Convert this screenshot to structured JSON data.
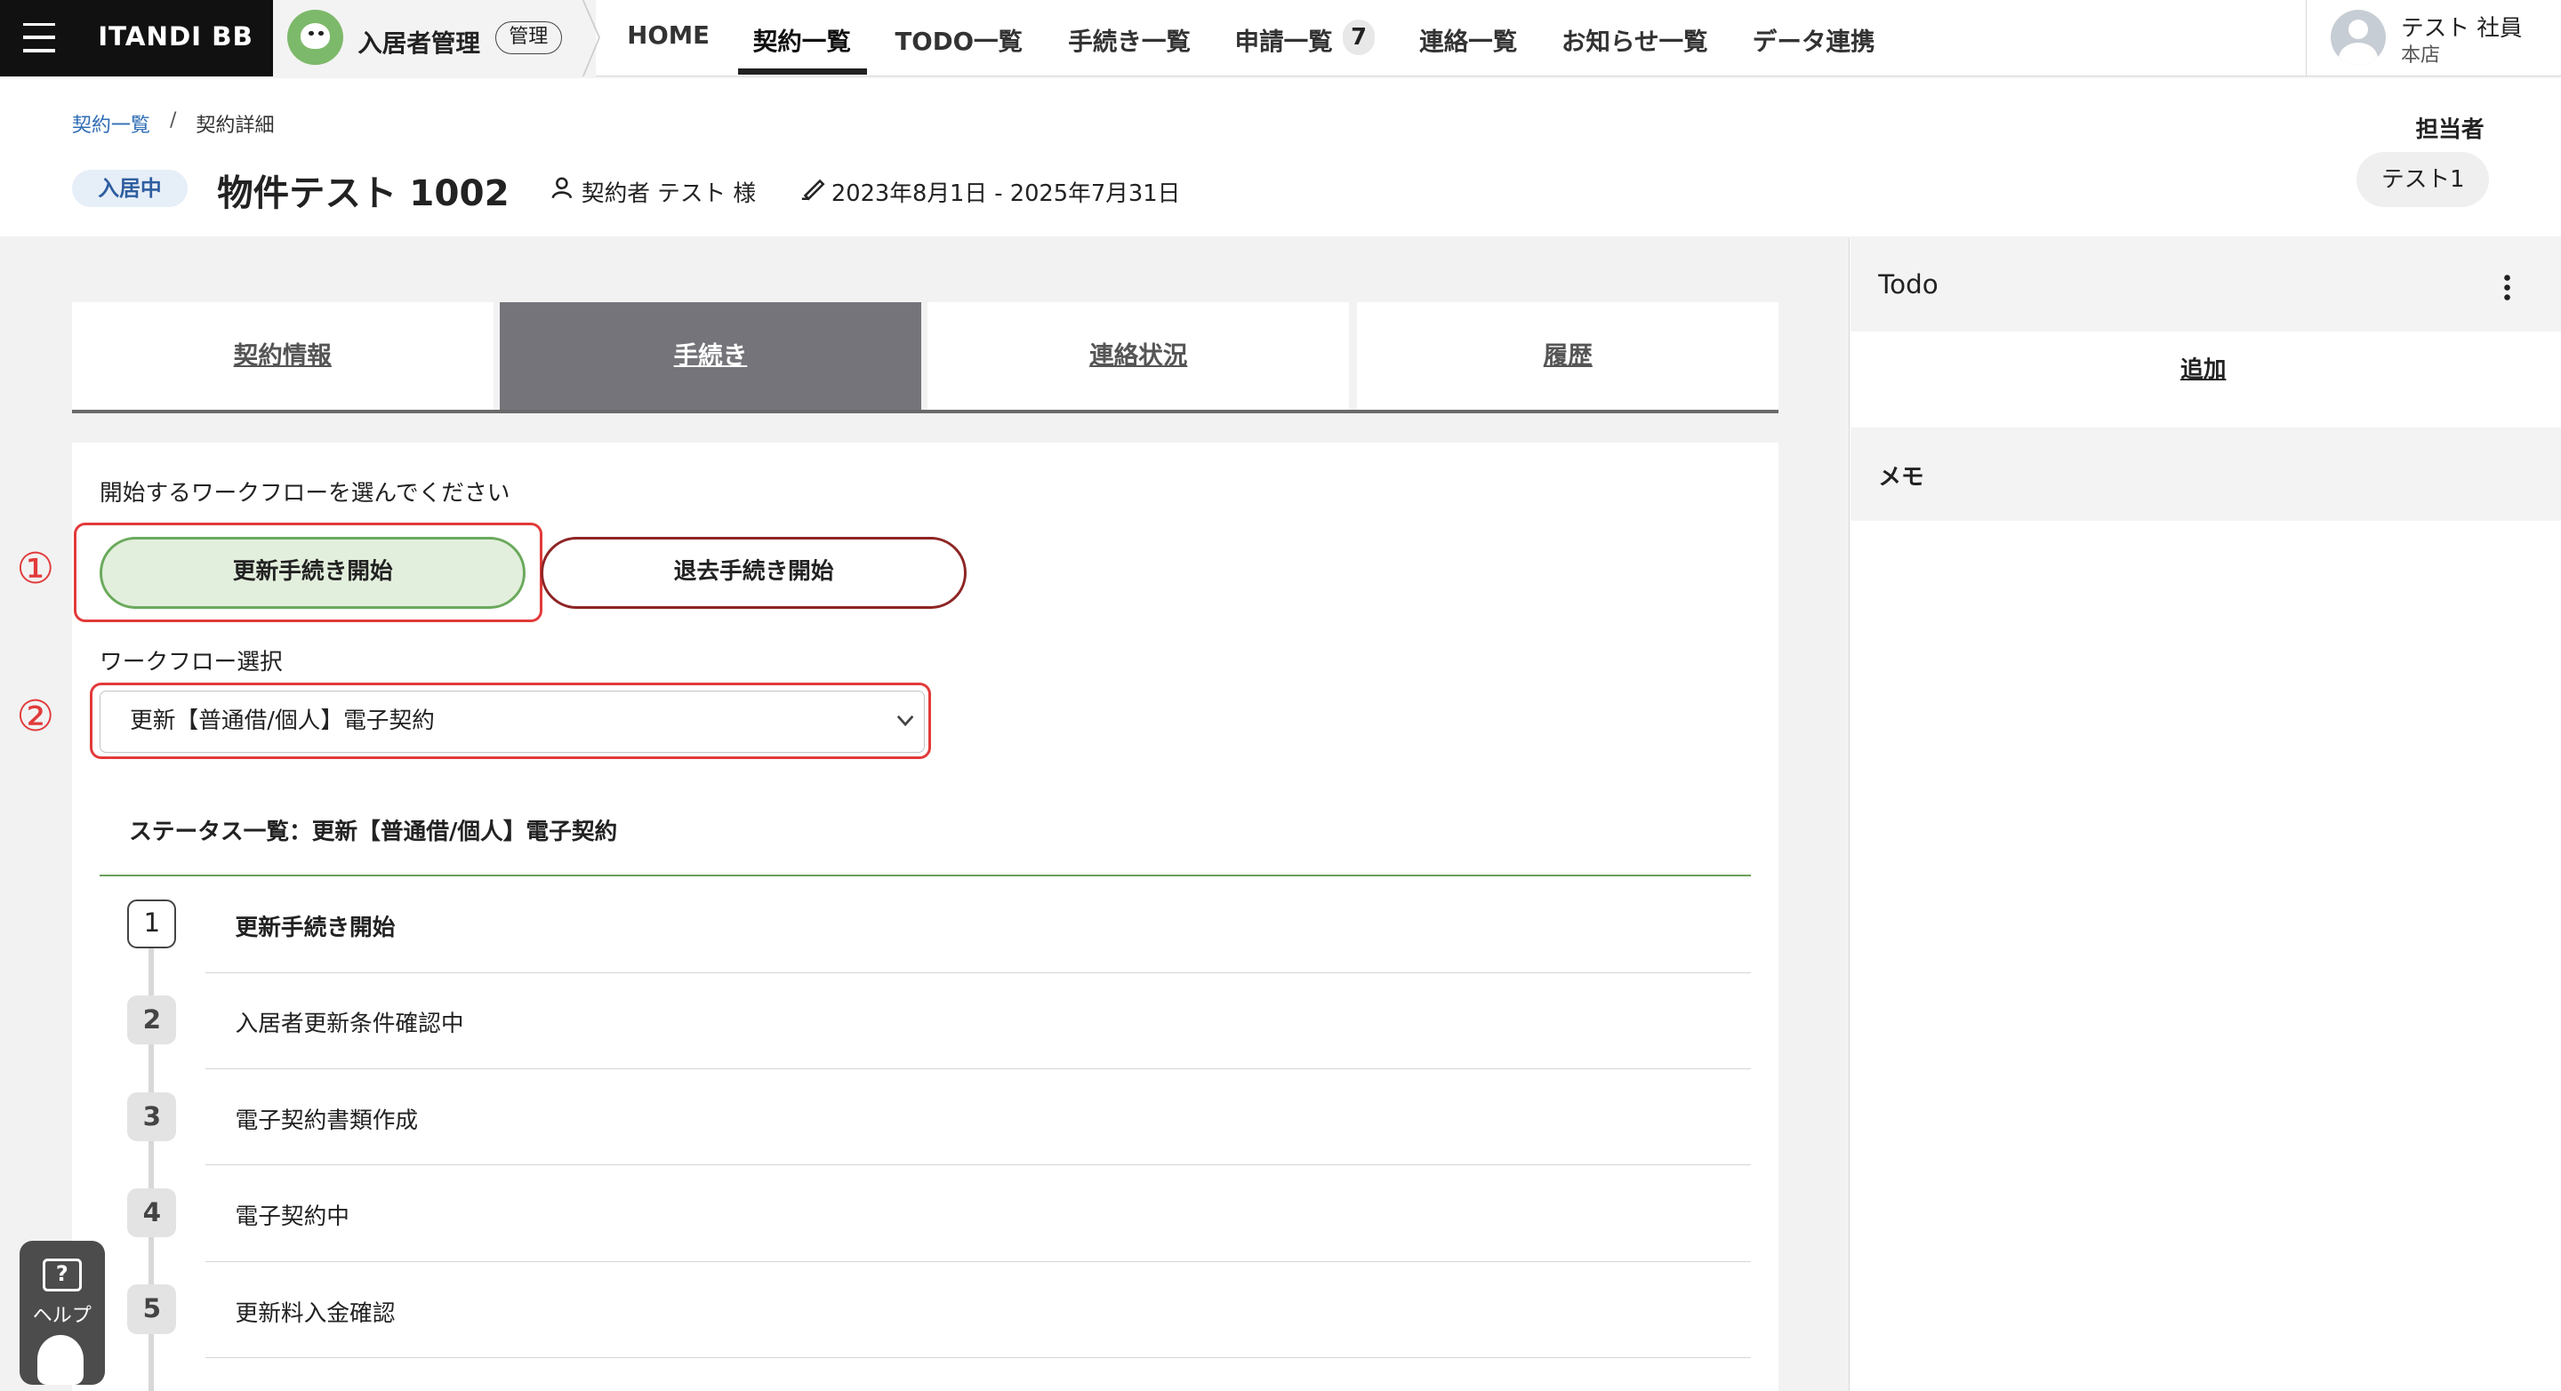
{
  "header": {
    "logo": "ITANDI BB",
    "app_title": "入居者管理",
    "app_badge": "管理",
    "nav": [
      {
        "label": "HOME"
      },
      {
        "label": "契約一覧"
      },
      {
        "label": "TODO一覧"
      },
      {
        "label": "手続き一覧"
      },
      {
        "label": "申請一覧"
      },
      {
        "label": "連絡一覧"
      },
      {
        "label": "お知らせ一覧"
      },
      {
        "label": "データ連携"
      }
    ],
    "application_count": "7",
    "user": {
      "name": "テスト 社員",
      "branch": "本店"
    }
  },
  "breadcrumb": {
    "parent": "契約一覧",
    "separator": "/",
    "current": "契約詳細"
  },
  "property": {
    "status": "入居中",
    "title": "物件テスト 1002",
    "contractor": "契約者 テスト 様",
    "period": "2023年8月1日 - 2025年7月31日"
  },
  "assignee": {
    "label": "担当者",
    "name": "テスト1"
  },
  "tabs": [
    {
      "label": "契約情報"
    },
    {
      "label": "手続き"
    },
    {
      "label": "連絡状況"
    },
    {
      "label": "履歴"
    }
  ],
  "workflow": {
    "prompt": "開始するワークフローを選んでください",
    "renew_button": "更新手続き開始",
    "past_button": "退去手続き開始",
    "select_label": "ワークフロー選択",
    "selected": "更新【普通借/個人】電子契約",
    "status_heading": "ステータス一覧：更新【普通借/個人】電子契約",
    "steps": [
      {
        "num": "1",
        "label": "更新手続き開始"
      },
      {
        "num": "2",
        "label": "入居者更新条件確認中"
      },
      {
        "num": "3",
        "label": "電子契約書類作成"
      },
      {
        "num": "4",
        "label": "電子契約中"
      },
      {
        "num": "5",
        "label": "更新料入金確認"
      }
    ]
  },
  "annotations": {
    "one": "①",
    "two": "②"
  },
  "sidebar": {
    "todo_title": "Todo",
    "add_label": "追加",
    "memo_title": "メモ"
  },
  "help": {
    "label": "ヘルプ",
    "icon": "?"
  },
  "colors": {
    "accent_green": "#6aaa5c",
    "highlight_red": "#e23a3a",
    "active_tab": "#75747a",
    "past_button_border": "#8e2525"
  }
}
